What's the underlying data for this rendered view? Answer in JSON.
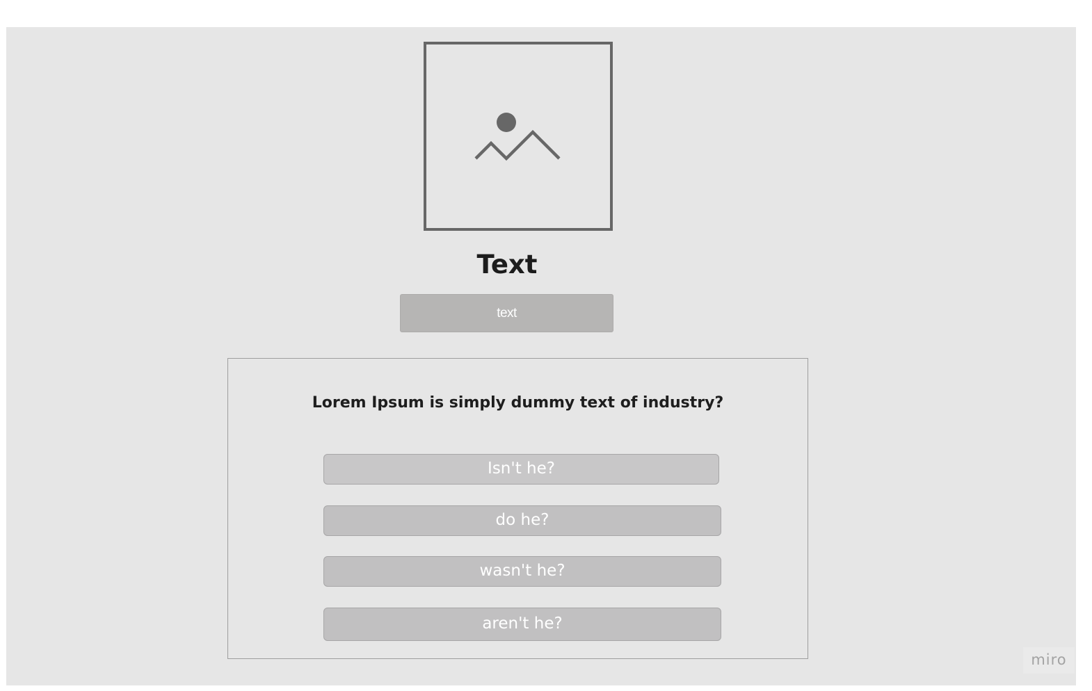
{
  "screen": {
    "title": "Text",
    "top_button_label": "text",
    "image_icon": "image-placeholder-icon"
  },
  "question": {
    "text": "Lorem Ipsum is simply dummy text of industry?",
    "answers": [
      {
        "label": "Isn't he?"
      },
      {
        "label": "do he?"
      },
      {
        "label": "wasn't he?"
      },
      {
        "label": "aren't he?"
      }
    ]
  },
  "watermark": {
    "label": "miro"
  },
  "colors": {
    "board_background": "#e6e6e6",
    "placeholder_stroke": "#676767",
    "top_button": "#b6b5b4",
    "answer_button": "#c1c0c1",
    "text_dark": "#1c1c1c"
  }
}
